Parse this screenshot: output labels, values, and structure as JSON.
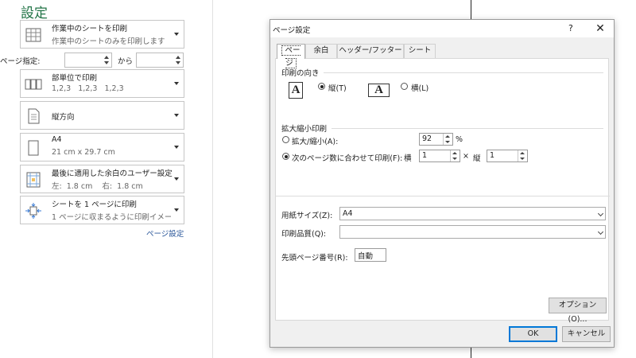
{
  "panel": {
    "title": "設定",
    "options": [
      {
        "line1": "作業中のシートを印刷",
        "line2": "作業中のシートのみを印刷します"
      },
      {
        "line1": "部単位で印刷",
        "line2": "1,2,3   1,2,3   1,2,3"
      },
      {
        "line1": "縦方向"
      },
      {
        "line1": "A4",
        "line2": "21 cm x 29.7 cm"
      },
      {
        "line1": "最後に適用した余白のユーザー設定",
        "line2": "左:  1.8 cm    右:  1.8 cm"
      },
      {
        "line1": "シートを 1 ページに印刷",
        "line2": "1 ページに収まるように印刷イメー…"
      }
    ],
    "pages_label": "ページ指定:",
    "pages_from": "",
    "pages_to_label": "から",
    "pages_to": "",
    "page_setup_link": "ページ設定"
  },
  "dialog": {
    "title": "ページ設定",
    "help": "?",
    "close": "✕",
    "tabs": [
      "ページ",
      "余白",
      "ヘッダー/フッター",
      "シート"
    ],
    "orientation": {
      "label": "印刷の向き",
      "portrait": "縦(T)",
      "landscape": "横(L)",
      "selected": "portrait",
      "icon_letter": "A"
    },
    "scaling": {
      "label": "拡大縮小印刷",
      "adjust_label": "拡大/縮小(A):",
      "adjust_value": "92",
      "percent": "%",
      "fit_label": "次のページ数に合わせて印刷(F):",
      "wide_label": "横",
      "wide_value": "1",
      "times": "×",
      "tall_label": "縦",
      "tall_value": "1",
      "selected": "fit"
    },
    "paper_size_label": "用紙サイズ(Z):",
    "paper_size_value": "A4",
    "print_quality_label": "印刷品質(Q):",
    "print_quality_value": "",
    "first_page_label": "先頭ページ番号(R):",
    "first_page_value": "自動",
    "options_button": "オプション(O)...",
    "ok": "OK",
    "cancel": "キャンセル"
  }
}
